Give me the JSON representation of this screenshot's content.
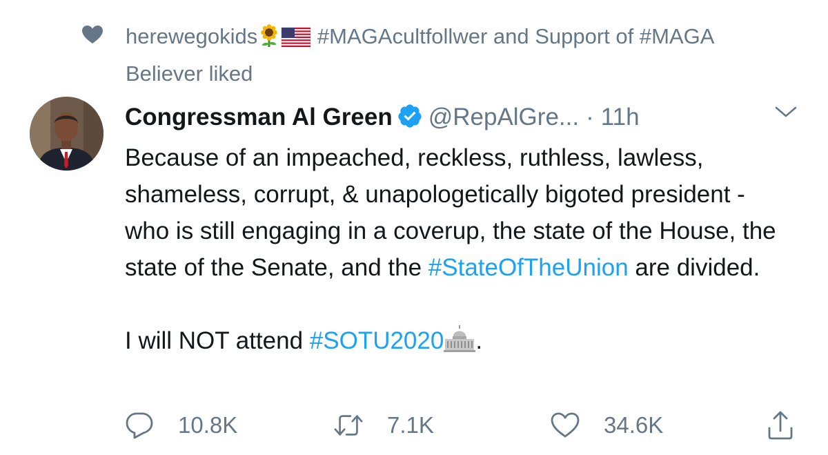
{
  "context": {
    "icon": "heart-icon",
    "user_name": "herewegokids",
    "emoji_1": "sunflower-emoji",
    "emoji_2": "us-flag-emoji",
    "rest": "#MAGAcultfollwer and Support of #MAGA Believer liked"
  },
  "tweet": {
    "author_name": "Congressman Al Green",
    "verified_icon": "verified-badge-icon",
    "handle": "@RepAlGre...",
    "separator": "·",
    "time": "11h",
    "body": {
      "p1_part1": "Because of an impeached, reckless, ruthless, lawless, shameless, corrupt, & unapologetically bigoted president - who is still engaging in a coverup, the state of the House, the state of the Senate, and the ",
      "p1_hashtag": "#StateOfTheUnion",
      "p1_part2": " are divided.",
      "p2_part1": "I will NOT attend ",
      "p2_hashtag": "#SOTU2020",
      "p2_emoji": "capitol-building-emoji",
      "p2_part2": "."
    }
  },
  "actions": {
    "reply_count": "10.8K",
    "retweet_count": "7.1K",
    "like_count": "34.6K"
  },
  "colors": {
    "text": "#14171a",
    "secondary": "#657786",
    "accent": "#1da1f2"
  }
}
